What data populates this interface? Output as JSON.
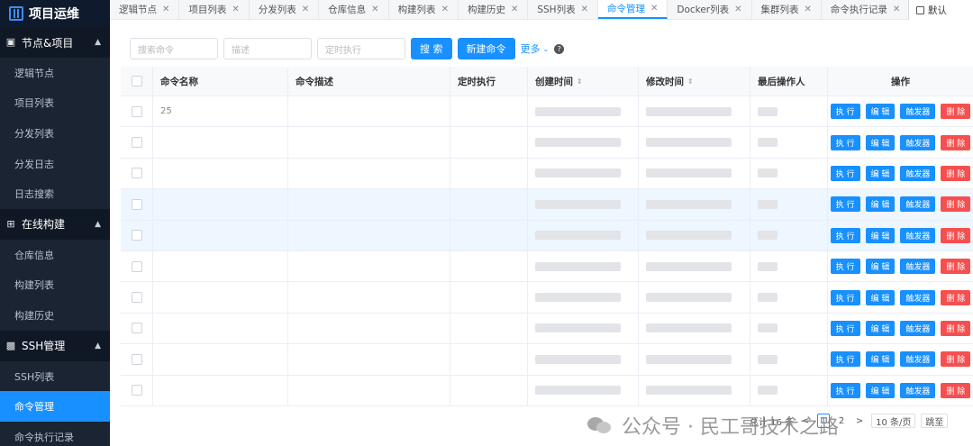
{
  "app": {
    "title": "项目运维"
  },
  "sidebar": {
    "groups": [
      {
        "label": "节点&项目",
        "icon": "sitemap-icon",
        "items": [
          "逻辑节点",
          "项目列表",
          "分发列表",
          "分发日志",
          "日志搜索"
        ]
      },
      {
        "label": "在线构建",
        "icon": "build-icon",
        "items": [
          "仓库信息",
          "构建列表",
          "构建历史"
        ]
      },
      {
        "label": "SSH管理",
        "icon": "terminal-icon",
        "items": [
          "SSH列表",
          "命令管理",
          "命令执行记录"
        ]
      }
    ],
    "active_item": "命令管理"
  },
  "tabs": {
    "items": [
      "逻辑节点",
      "项目列表",
      "分发列表",
      "仓库信息",
      "构建列表",
      "构建历史",
      "SSH列表",
      "命令管理",
      "Docker列表",
      "集群列表",
      "命令执行记录"
    ],
    "active": "命令管理",
    "default_label": "默认"
  },
  "toolbar": {
    "search_placeholder": "搜索命令",
    "desc_placeholder": "描述",
    "cron_placeholder": "定时执行",
    "search_label": "搜 索",
    "new_label": "新建命令",
    "more_label": "更多"
  },
  "table": {
    "headers": [
      "命令名称",
      "命令描述",
      "定时执行",
      "创建时间",
      "修改时间",
      "最后操作人",
      "操作"
    ],
    "row_fragments": [
      "25",
      "",
      "",
      "",
      "",
      "",
      "",
      "",
      "",
      ""
    ],
    "ops": [
      "执 行",
      "编 辑",
      "触发器",
      "删 除"
    ],
    "highlight_rows": [
      3,
      4
    ]
  },
  "pagination": {
    "total_label": "总计 16 条",
    "prev": "<",
    "pages": [
      "1",
      "2"
    ],
    "next": ">",
    "current_page": "1",
    "page_size_label": "10 条/页",
    "goto_label": "跳至"
  },
  "watermark": {
    "text": "公众号 · 民工哥技术之路"
  }
}
